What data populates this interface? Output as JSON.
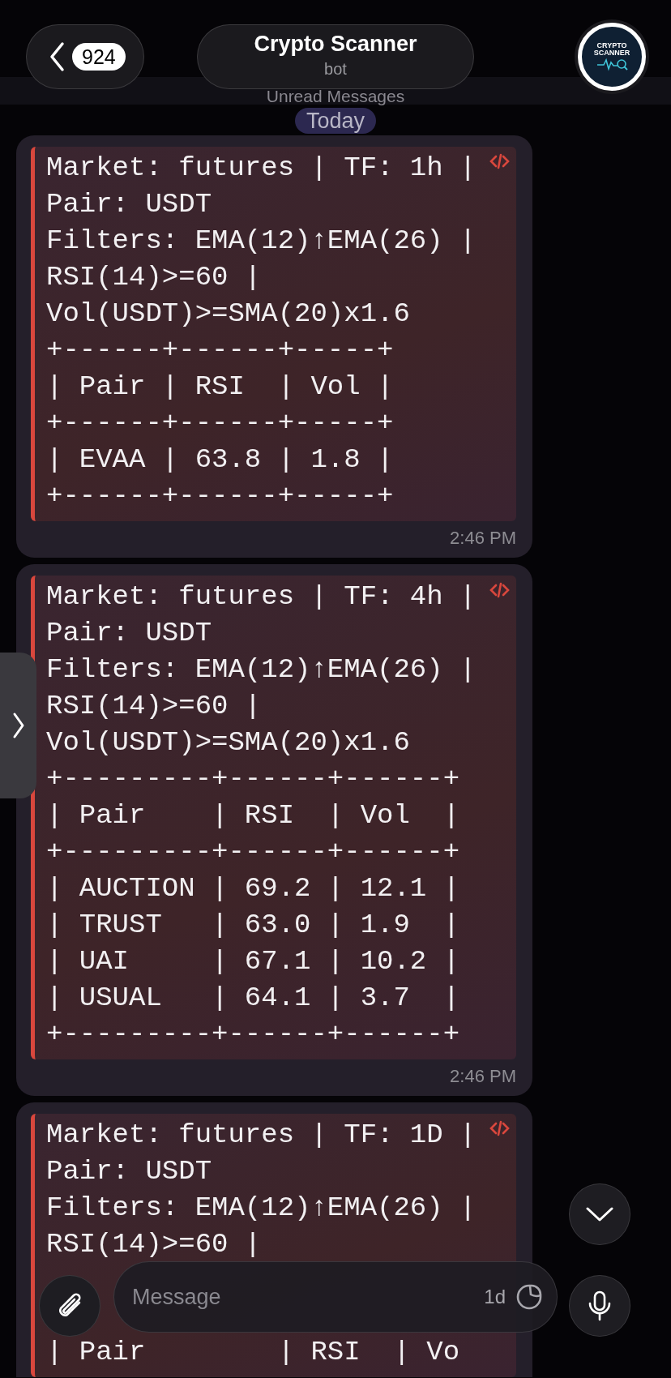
{
  "header": {
    "back_count": "924",
    "title": "Crypto Scanner",
    "subtitle": "bot",
    "avatar_text": [
      "CRYPTO",
      "SCANNER"
    ]
  },
  "unread_label": "Unread Messages",
  "date_chip": "Today",
  "messages": [
    {
      "lines": [
        "Market: futures | TF: 1h |",
        "Pair: USDT",
        "Filters: EMA(12)↑EMA(26) |",
        "RSI(14)>=60 |",
        "Vol(USDT)>=SMA(20)x1.6",
        "+------+------+-----+",
        "| Pair | RSI  | Vol |",
        "+------+------+-----+",
        "| EVAA | 63.8 | 1.8 |",
        "+------+------+-----+"
      ],
      "time": "2:46 PM"
    },
    {
      "lines": [
        "Market: futures | TF: 4h |",
        "Pair: USDT",
        "Filters: EMA(12)↑EMA(26) |",
        "RSI(14)>=60 |",
        "Vol(USDT)>=SMA(20)x1.6",
        "+---------+------+------+",
        "| Pair    | RSI  | Vol  |",
        "+---------+------+------+",
        "| AUCTION | 69.2 | 12.1 |",
        "| TRUST   | 63.0 | 1.9  |",
        "| UAI     | 67.1 | 10.2 |",
        "| USUAL   | 64.1 | 3.7  |",
        "+---------+------+------+"
      ],
      "time": "2:46 PM"
    },
    {
      "lines": [
        "Market: futures | TF: 1D |",
        "Pair: USDT",
        "Filters: EMA(12)↑EMA(26) |",
        "RSI(14)>=60 |"
      ],
      "lines_after_composer": [
        "| Pair        | RSI  | Vo"
      ]
    }
  ],
  "composer": {
    "placeholder": "Message",
    "timer": "1d"
  }
}
